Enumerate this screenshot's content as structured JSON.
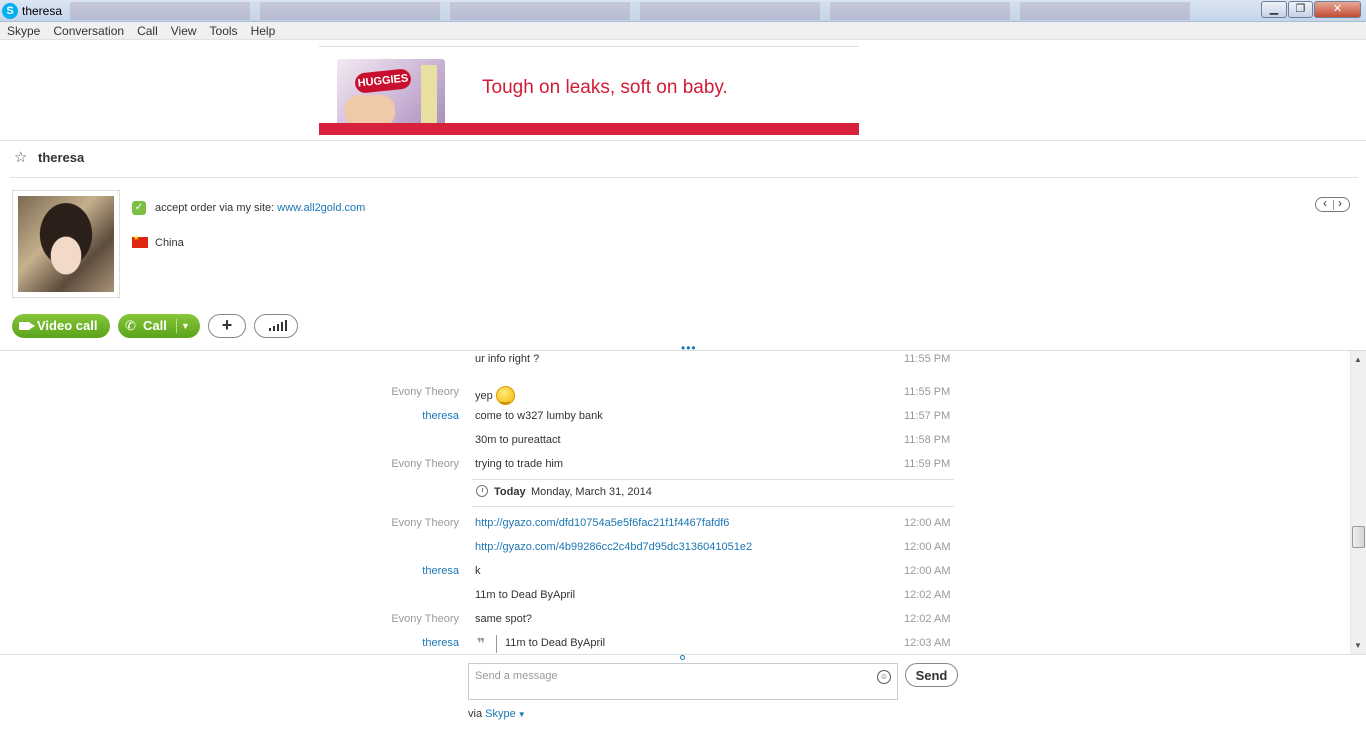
{
  "window": {
    "title": "theresa",
    "app_icon": "skype-icon",
    "min": "▁",
    "max": "❐",
    "close": "✕"
  },
  "menu": [
    "Skype",
    "Conversation",
    "Call",
    "View",
    "Tools",
    "Help"
  ],
  "ad": {
    "brand": "HUGGIES",
    "tagline": "Tough on leaks, soft on baby."
  },
  "contact": {
    "name": "theresa",
    "mood_text": "accept order via my site: ",
    "mood_link": "www.all2gold.com",
    "country": "China"
  },
  "actions": {
    "video_call": "Video call",
    "call": "Call"
  },
  "conversation": {
    "messages": [
      {
        "sender": "",
        "sender_color": "gray",
        "text": "ur info right ?",
        "time": "11:55 PM"
      },
      {
        "sender": "Evony Theory",
        "sender_color": "gray",
        "text": "yep",
        "time": "11:55 PM",
        "emoticon": "smile-icon"
      },
      {
        "sender": "theresa",
        "sender_color": "blue",
        "text": "come to w327 lumby bank",
        "time": "11:57 PM"
      },
      {
        "sender": "",
        "sender_color": "gray",
        "text": "30m to pureattact",
        "time": "11:58 PM"
      },
      {
        "sender": "Evony Theory",
        "sender_color": "gray",
        "text": "trying to trade him",
        "time": "11:59 PM"
      },
      {
        "sender": "Evony Theory",
        "sender_color": "gray",
        "text": "http://gyazo.com/dfd10754a5e5f6fac21f1f4467fafdf6",
        "time": "12:00 AM",
        "is_link": true
      },
      {
        "sender": "",
        "sender_color": "gray",
        "text": "http://gyazo.com/4b99286cc2c4bd7d95dc3136041051e2",
        "time": "12:00 AM",
        "is_link": true
      },
      {
        "sender": "theresa",
        "sender_color": "blue",
        "text": "k",
        "time": "12:00 AM"
      },
      {
        "sender": "",
        "sender_color": "gray",
        "text": "11m to Dead ByApril",
        "time": "12:02 AM"
      },
      {
        "sender": "Evony Theory",
        "sender_color": "gray",
        "text": "same spot?",
        "time": "12:02 AM"
      },
      {
        "sender": "theresa",
        "sender_color": "blue",
        "text": "11m to Dead ByApril",
        "time": "12:03 AM",
        "is_quote": true
      }
    ],
    "date_separator": {
      "today": "Today",
      "date": "Monday, March 31, 2014"
    }
  },
  "compose": {
    "placeholder": "Send a message",
    "send": "Send",
    "via_prefix": "via ",
    "via_service": "Skype"
  }
}
